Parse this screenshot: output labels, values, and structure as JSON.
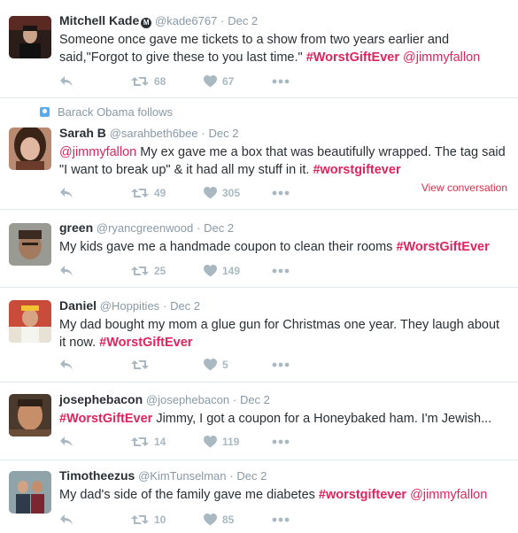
{
  "colors": {
    "hashtag": "#e0245e",
    "muted": "#8899a6",
    "action": "#aab8c2",
    "view_conversation": "#d62f4a"
  },
  "icons": {
    "reply": "reply-icon",
    "retweet": "retweet-icon",
    "like": "heart-icon",
    "more": "more-dots-icon",
    "follows": "person-icon"
  },
  "tweets": [
    {
      "name": "Mitchell Kade",
      "badge": "M",
      "handle": "@kade6767",
      "dot": "·",
      "time": "Dec 2",
      "text_plain": "Someone once gave me tickets to a show from two years earlier and said,\"Forgot to give these to you last time.\" ",
      "hashtag": "#WorstGiftEver",
      "mention_after": "@jimmyfallon",
      "retweets": "68",
      "likes": "67"
    },
    {
      "context": "Barack Obama follows",
      "name": "Sarah B",
      "handle": "@sarahbeth6bee",
      "dot": "·",
      "time": "Dec 2",
      "mention_before": "@jimmyfallon",
      "text_plain": " My ex gave me a box that was beautifully wrapped. The tag said \"I want to break up\" & it had all my stuff in it. ",
      "hashtag": "#worstgiftever",
      "retweets": "49",
      "likes": "305",
      "view_conversation": "View conversation"
    },
    {
      "name": "green",
      "handle": "@ryancgreenwood",
      "dot": "·",
      "time": "Dec 2",
      "text_plain": "My kids gave me a handmade coupon to clean their rooms ",
      "hashtag": "#WorstGiftEver",
      "retweets": "25",
      "likes": "149"
    },
    {
      "name": "Daniel",
      "handle": "@Hoppities",
      "dot": "·",
      "time": "Dec 2",
      "text_plain": "My dad bought my mom a glue gun for Christmas one year. They laugh about it now. ",
      "hashtag": "#WorstGiftEver",
      "likes": "5"
    },
    {
      "name": "josephebacon",
      "handle": "@josephebacon",
      "dot": "·",
      "time": "Dec 2",
      "hashtag": "#WorstGiftEver",
      "text_plain": " Jimmy, I got a coupon for a Honeybaked ham. I'm Jewish...",
      "retweets": "14",
      "likes": "119"
    },
    {
      "name": "Timotheezus",
      "handle": "@KimTunselman",
      "dot": "·",
      "time": "Dec 2",
      "text_plain": "My dad's side of the family gave me diabetes ",
      "hashtag": "#worstgiftever",
      "mention_after": "@jimmyfallon",
      "retweets": "10",
      "likes": "85"
    }
  ]
}
